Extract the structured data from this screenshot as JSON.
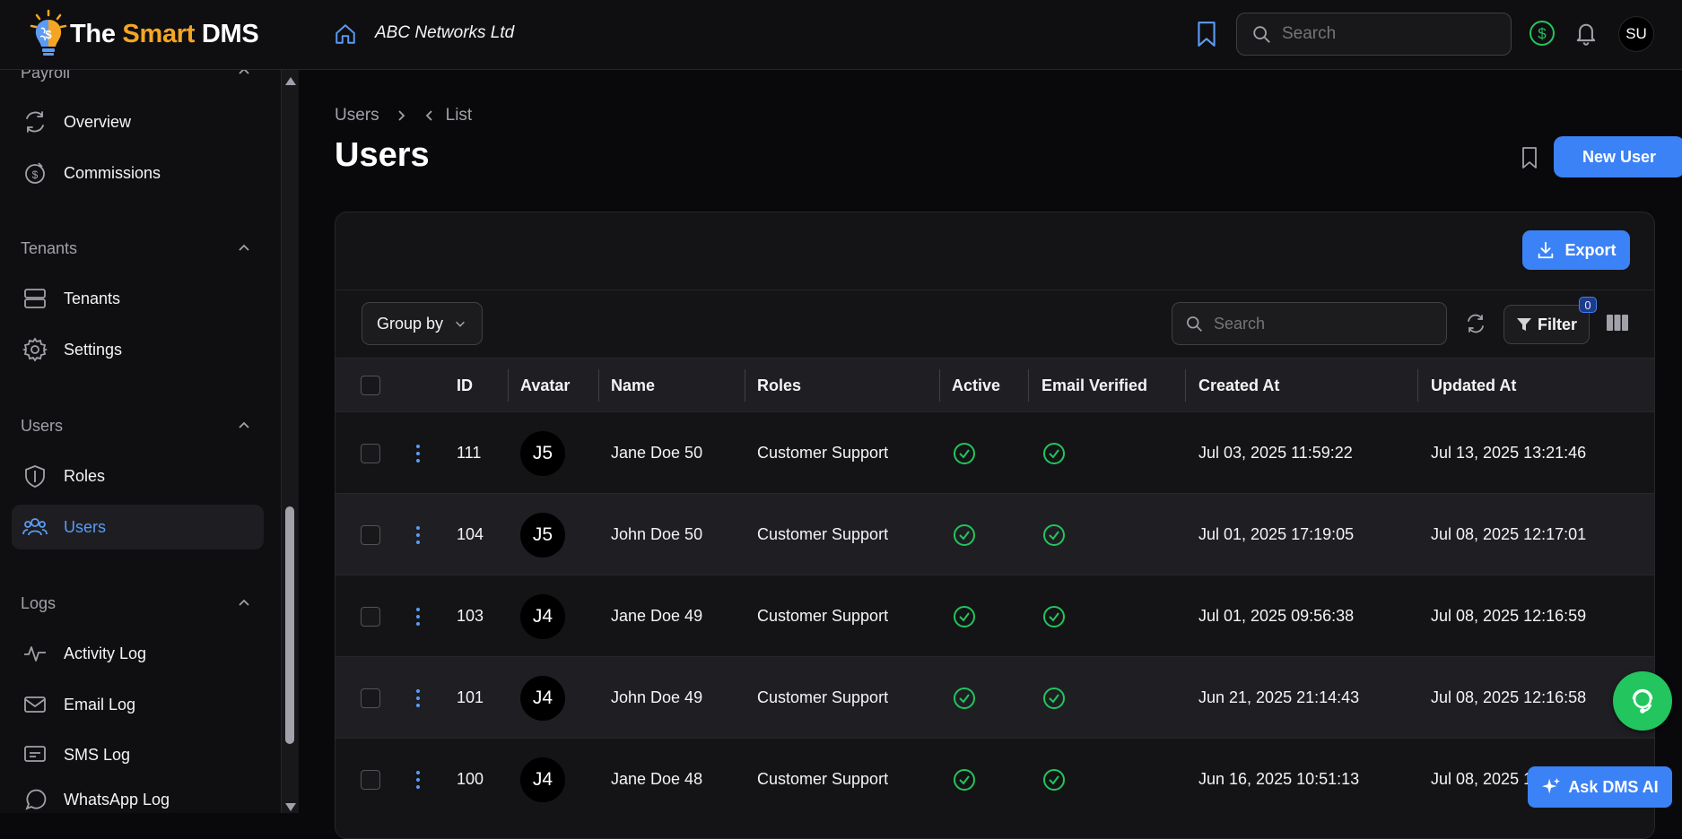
{
  "app": {
    "name_part1": "The ",
    "name_part2": "Smart",
    "name_part3": " DMS",
    "company": "ABC Networks Ltd",
    "user_initials": "SU",
    "search_placeholder": "Search",
    "accent_color": "#3b82f6",
    "success_color": "#22c55e",
    "brand_color": "#f5a524"
  },
  "sidebar": {
    "groups": [
      {
        "label": "Payroll",
        "items": [
          {
            "label": "Overview",
            "icon": "refresh-cycle-icon"
          },
          {
            "label": "Commissions",
            "icon": "coin-clock-icon"
          }
        ]
      },
      {
        "label": "Tenants",
        "items": [
          {
            "label": "Tenants",
            "icon": "server-icon"
          },
          {
            "label": "Settings",
            "icon": "gear-icon"
          }
        ]
      },
      {
        "label": "Users",
        "items": [
          {
            "label": "Roles",
            "icon": "shield-icon"
          },
          {
            "label": "Users",
            "icon": "users-icon",
            "active": true
          }
        ]
      },
      {
        "label": "Logs",
        "items": [
          {
            "label": "Activity Log",
            "icon": "activity-icon"
          },
          {
            "label": "Email Log",
            "icon": "mail-icon"
          },
          {
            "label": "SMS Log",
            "icon": "sms-icon"
          },
          {
            "label": "WhatsApp Log",
            "icon": "whatsapp-icon"
          }
        ]
      }
    ]
  },
  "page": {
    "breadcrumb": [
      "Users",
      "List"
    ],
    "title": "Users",
    "new_user_label": "New User",
    "export_label": "Export",
    "group_by_label": "Group by",
    "table_search_placeholder": "Search",
    "filter_label": "Filter",
    "filter_count": "0"
  },
  "table": {
    "columns": [
      "ID",
      "Avatar",
      "Name",
      "Roles",
      "Active",
      "Email Verified",
      "Created At",
      "Updated At"
    ],
    "rows": [
      {
        "id": "111",
        "avatar": "J5",
        "name": "Jane Doe 50",
        "role": "Customer Support",
        "active": true,
        "verified": true,
        "created": "Jul 03, 2025 11:59:22",
        "updated": "Jul 13, 2025 13:21:46"
      },
      {
        "id": "104",
        "avatar": "J5",
        "name": "John Doe 50",
        "role": "Customer Support",
        "active": true,
        "verified": true,
        "created": "Jul 01, 2025 17:19:05",
        "updated": "Jul 08, 2025 12:17:01"
      },
      {
        "id": "103",
        "avatar": "J4",
        "name": "Jane Doe 49",
        "role": "Customer Support",
        "active": true,
        "verified": true,
        "created": "Jul 01, 2025 09:56:38",
        "updated": "Jul 08, 2025 12:16:59"
      },
      {
        "id": "101",
        "avatar": "J4",
        "name": "John Doe 49",
        "role": "Customer Support",
        "active": true,
        "verified": true,
        "created": "Jun 21, 2025 21:14:43",
        "updated": "Jul 08, 2025 12:16:58"
      },
      {
        "id": "100",
        "avatar": "J4",
        "name": "Jane Doe 48",
        "role": "Customer Support",
        "active": true,
        "verified": true,
        "created": "Jun 16, 2025 10:51:13",
        "updated": "Jul 08, 2025 12:16:57"
      }
    ]
  },
  "ai": {
    "label": "Ask DMS AI"
  }
}
